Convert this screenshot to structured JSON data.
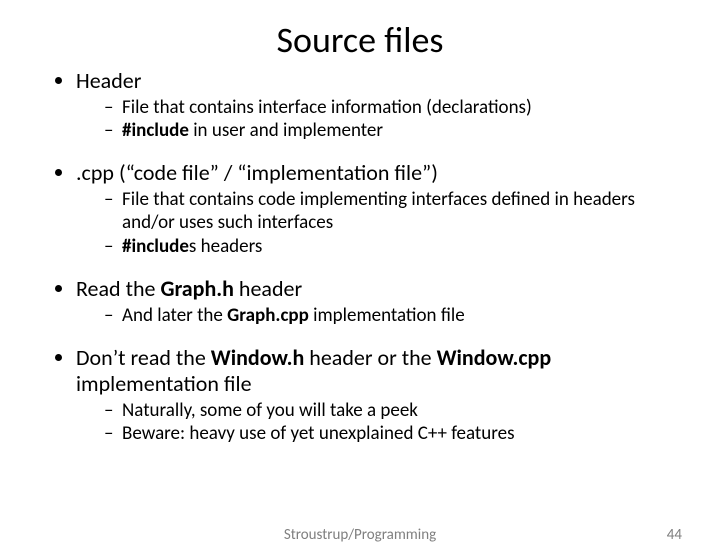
{
  "title": "Source files",
  "bullets": {
    "b1": "Header",
    "b1s1": "File that contains interface information (declarations)",
    "b1s2a": "#include",
    "b1s2b": " in user and implementer",
    "b2": ".cpp (“code file” / “implementation file”)",
    "b2s1": "File that contains code implementing interfaces defined in headers and/or uses such interfaces",
    "b2s2a": "#include",
    "b2s2b": "s headers",
    "b3a": "Read the ",
    "b3b": "Graph.h",
    "b3c": " header",
    "b3s1a": "And later the ",
    "b3s1b": "Graph.cpp",
    "b3s1c": " implementation file",
    "b4a": "Don’t read the ",
    "b4b": "Window.h",
    "b4c": " header or the ",
    "b4d": "Window.cpp",
    "b4e": " implementation file",
    "b4s1": "Naturally, some of you will take a peek",
    "b4s2": "Beware: heavy use of yet unexplained C++ features"
  },
  "footer": {
    "center": "Stroustrup/Programming",
    "page": "44"
  }
}
